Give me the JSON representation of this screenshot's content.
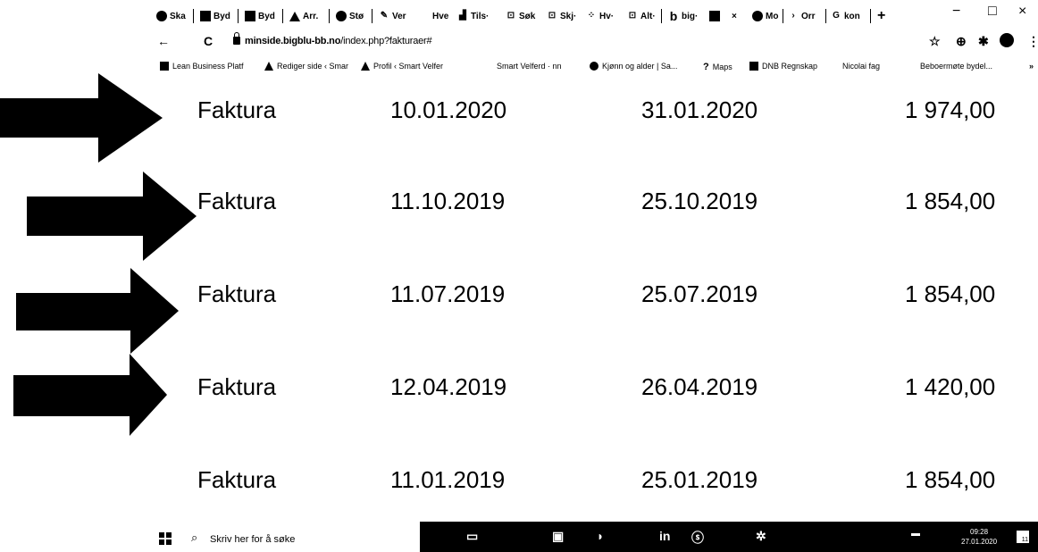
{
  "browser": {
    "tabs": [
      {
        "label": "Ska",
        "icon": "globe-icon"
      },
      {
        "label": "Byd",
        "icon": "document-icon"
      },
      {
        "label": "Byd",
        "icon": "document-icon"
      },
      {
        "label": "Arr.",
        "icon": "ship-icon"
      },
      {
        "label": "Stø",
        "icon": "globe-icon"
      },
      {
        "label": "Ver",
        "icon": "pen-icon"
      },
      {
        "label": "Hve",
        "icon": "none"
      },
      {
        "label": "Tils·",
        "icon": "signal-icon"
      },
      {
        "label": "Søk",
        "icon": "box-icon"
      },
      {
        "label": "Skj·",
        "icon": "box-icon"
      },
      {
        "label": "Hv·",
        "icon": "dots-icon"
      },
      {
        "label": "Alt·",
        "icon": "box-icon"
      },
      {
        "label": "big·",
        "icon": "b-icon"
      },
      {
        "label": "×",
        "icon": "image-icon"
      },
      {
        "label": "Mo",
        "icon": "circle-icon"
      },
      {
        "label": "Orr",
        "icon": "chevron-icon"
      },
      {
        "label": "kon",
        "icon": "g-icon"
      }
    ],
    "new_tab": "+",
    "window": {
      "minimize": "−",
      "maximize": "□",
      "close": "×"
    },
    "back": "←",
    "reload": "C",
    "url_host": "minside.bigblu-bb.no",
    "url_path": "/index.php?fakturaer#",
    "toolbar_icons": [
      "star-icon",
      "zoom-icon",
      "extension-icon",
      "profile-icon",
      "menu-icon"
    ],
    "menu": "⋮",
    "star": "☆",
    "bookmarks": [
      {
        "label": "Lean Business Platf"
      },
      {
        "label": "Rediger side ‹ Smar"
      },
      {
        "label": "Profil ‹ Smart Velfer"
      },
      {
        "label": "Smart Velferd · nn"
      },
      {
        "label": "Kjønn og alder | Sa..."
      },
      {
        "label": "Maps"
      },
      {
        "label": "DNB Regnskap"
      },
      {
        "label": "Nicolai fag"
      },
      {
        "label": "Beboermøte bydel..."
      }
    ],
    "bookmarks_more": "»"
  },
  "invoices": [
    {
      "type": "Faktura",
      "date": "10.01.2020",
      "due": "31.01.2020",
      "amount": "1 974,00"
    },
    {
      "type": "Faktura",
      "date": "11.10.2019",
      "due": "25.10.2019",
      "amount": "1 854,00"
    },
    {
      "type": "Faktura",
      "date": "11.07.2019",
      "due": "25.07.2019",
      "amount": "1 854,00"
    },
    {
      "type": "Faktura",
      "date": "12.04.2019",
      "due": "26.04.2019",
      "amount": "1 420,00"
    },
    {
      "type": "Faktura",
      "date": "11.01.2019",
      "due": "25.01.2019",
      "amount": "1 854,00"
    }
  ],
  "taskbar": {
    "search_placeholder": "Skriv her for å søke",
    "time": "09:28",
    "date": "27.01.2020",
    "notifications": "11"
  }
}
